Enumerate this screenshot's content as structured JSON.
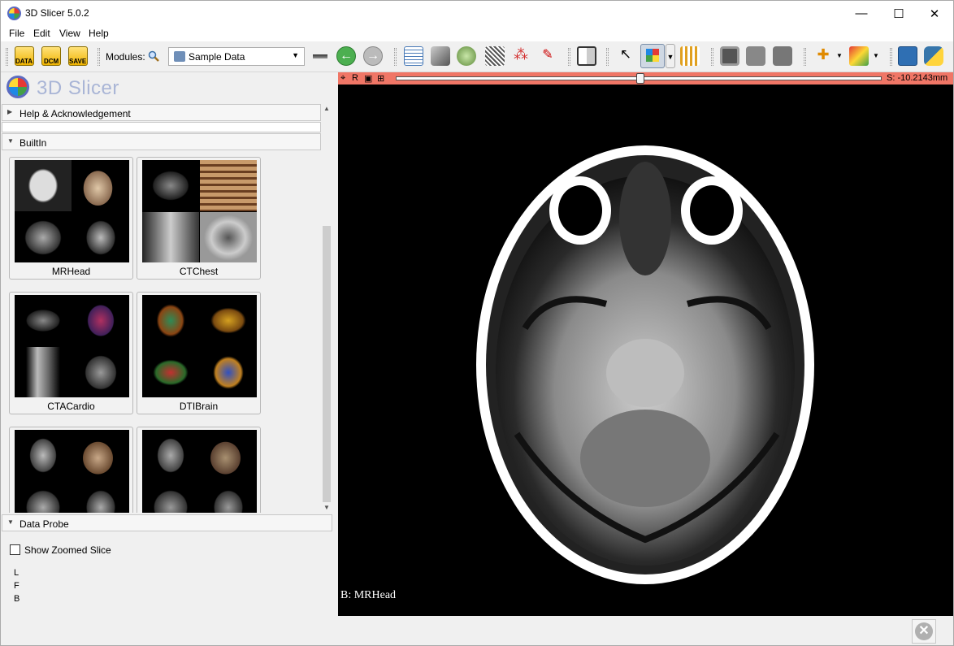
{
  "window": {
    "title": "3D Slicer 5.0.2",
    "minimize": "—",
    "maximize": "☐",
    "close": "✕"
  },
  "menu": [
    "File",
    "Edit",
    "View",
    "Help"
  ],
  "toolbar": {
    "data_label": "DATA",
    "dcm_label": "DCM",
    "save_label": "SAVE",
    "modules_label": "Modules:",
    "module_selected": "Sample Data"
  },
  "logo": {
    "text": "3D Slicer"
  },
  "panel": {
    "help_section": "Help & Acknowledgement",
    "builtin_section": "BuiltIn",
    "datasets": [
      "MRHead",
      "CTChest",
      "CTACardio",
      "DTIBrain",
      "",
      ""
    ],
    "data_probe_section": "Data Probe",
    "show_zoomed_slice": "Show Zoomed Slice",
    "probe_coords": [
      "L",
      "F",
      "B"
    ]
  },
  "view": {
    "orientation": "R",
    "slice_offset": "S: -10.2143mm",
    "slider_fraction": 0.5,
    "background_label": "B: MRHead"
  },
  "colors": {
    "view_bar": "#f07666",
    "logo_text": "#a9b5d6"
  }
}
